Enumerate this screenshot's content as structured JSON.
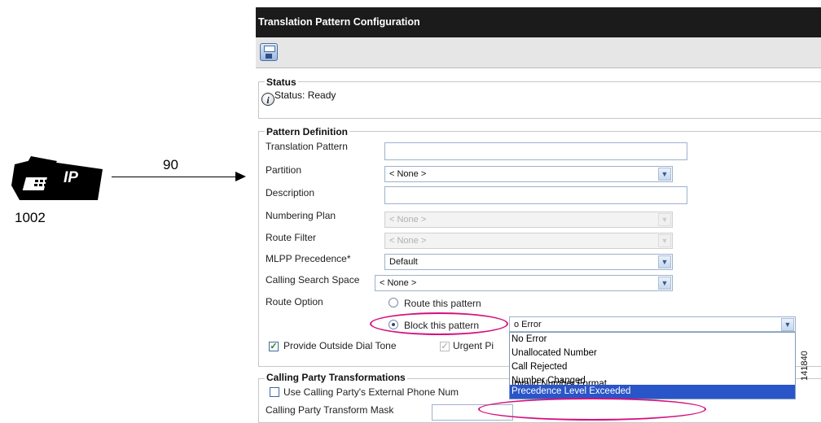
{
  "diagram": {
    "phone_label": "IP",
    "phone_extension": "1002",
    "dialed_digits": "90"
  },
  "window": {
    "title": "Translation Pattern Configuration",
    "toolbar": {
      "save_icon": "save-icon"
    }
  },
  "status": {
    "legend": "Status",
    "icon": "info-icon",
    "text": "Status: Ready"
  },
  "pattern_definition": {
    "legend": "Pattern Definition",
    "fields": {
      "translation_pattern": {
        "label": "Translation Pattern",
        "value": ""
      },
      "partition": {
        "label": "Partition",
        "value": "< None >"
      },
      "description": {
        "label": "Description",
        "value": ""
      },
      "numbering_plan": {
        "label": "Numbering Plan",
        "value": "< None >"
      },
      "route_filter": {
        "label": "Route Filter",
        "value": "< None >"
      },
      "mlpp_precedence": {
        "label": "MLPP Precedence*",
        "value": "Default"
      },
      "calling_search_space": {
        "label": "Calling Search Space",
        "value": "< None >"
      }
    },
    "route_option": {
      "label": "Route Option",
      "route_this_pattern": "Route this pattern",
      "block_this_pattern": "Block this pattern",
      "block_reason_value": "o Error",
      "selected": "block"
    },
    "provide_outside_dial_tone": {
      "label": "Provide Outside Dial Tone",
      "checked": true
    },
    "urgent_priority": {
      "label": "Urgent Pi",
      "checked": true
    }
  },
  "block_reason_options": [
    "No Error",
    "Unallocated Number",
    "Call Rejected",
    "Number Changed",
    "Invalid Number Format",
    "Precedence Level Exceeded"
  ],
  "block_reason_selected_index": 5,
  "calling_party_transformations": {
    "legend": "Calling Party Transformations",
    "use_external_phone_mask": {
      "label": "Use Calling Party's External Phone Num",
      "checked": false
    },
    "transform_mask": {
      "label": "Calling Party Transform Mask",
      "value": ""
    }
  },
  "figure_id": "141840",
  "highlight_color": "#d4117d"
}
